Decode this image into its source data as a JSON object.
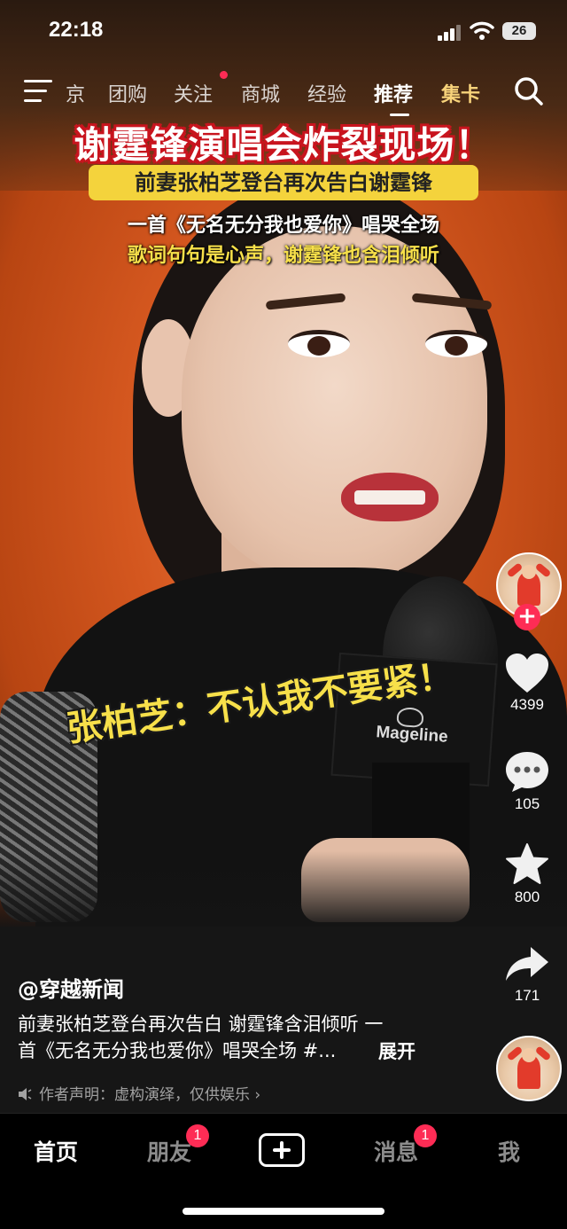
{
  "status": {
    "time": "22:18",
    "battery": "26"
  },
  "nav": {
    "tabs": [
      "京",
      "团购",
      "关注",
      "商城",
      "经验",
      "推荐",
      "集卡"
    ],
    "active": "推荐"
  },
  "video": {
    "title": "谢霆锋演唱会炸裂现场！",
    "banner": "前妻张柏芝登台再次告白谢霆锋",
    "line1": "一首《无名无分我也爱你》唱哭全场",
    "line2": "歌词句句是心声，谢霆锋也含泪倾听",
    "quote": "张柏芝：不认我不要紧！",
    "mic_brand": "Mageline"
  },
  "actions": {
    "likes": "4399",
    "comments": "105",
    "favorites": "800",
    "shares": "171"
  },
  "post": {
    "author": "@穿越新闻",
    "desc_line1": "前妻张柏芝登台再次告白 谢霆锋含泪倾听 一",
    "desc_line2": "首《无名无分我也爱你》唱哭全场 #...",
    "expand": "展开",
    "disclaimer": "作者声明：虚构演绎，仅供娱乐 ›"
  },
  "tabbar": {
    "home": "首页",
    "friends": "朋友",
    "friends_badge": "1",
    "messages": "消息",
    "messages_badge": "1",
    "me": "我"
  },
  "colors": {
    "accent": "#fe2c55",
    "caption_red": "#c8141e",
    "banner_yellow": "#f4d33c",
    "quote_yellow": "#f7e04a"
  }
}
